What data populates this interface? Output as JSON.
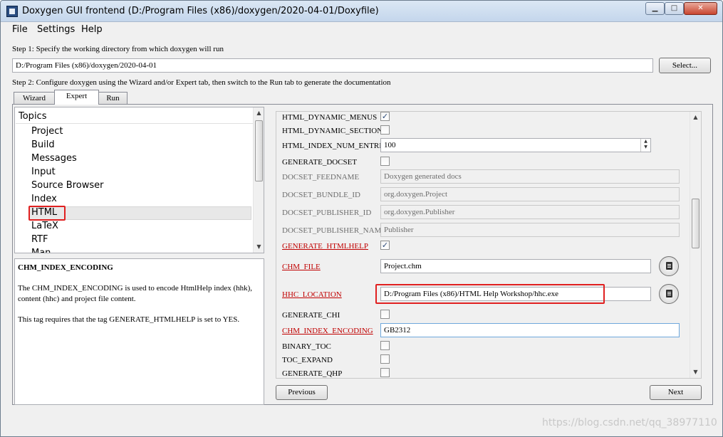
{
  "window": {
    "title": "Doxygen GUI frontend (D:/Program Files (x86)/doxygen/2020-04-01/Doxyfile)",
    "minimize_glyph": "▁",
    "maximize_glyph": "□",
    "close_glyph": "✕"
  },
  "menu": [
    "File",
    "Settings",
    "Help"
  ],
  "step1": {
    "label": "Step 1: Specify the working directory from which doxygen will run",
    "workdir": "D:/Program Files (x86)/doxygen/2020-04-01",
    "select_label": "Select..."
  },
  "step2": {
    "label": "Step 2: Configure doxygen using the Wizard and/or Expert tab, then switch to the Run tab to generate the documentation"
  },
  "tabs": [
    "Wizard",
    "Expert",
    "Run"
  ],
  "active_tab": "Expert",
  "topics": {
    "header": "Topics",
    "items": [
      "Project",
      "Build",
      "Messages",
      "Input",
      "Source Browser",
      "Index",
      "HTML",
      "LaTeX",
      "RTF",
      "Man"
    ],
    "selected": "HTML"
  },
  "help": {
    "title": "CHM_INDEX_ENCODING",
    "paragraph1": "The CHM_INDEX_ENCODING is used to encode HtmlHelp index (hhk), content (hhc) and project file content.",
    "paragraph2": "This tag requires that the tag GENERATE_HTMLHELP is set to YES."
  },
  "settings": [
    {
      "label": "HTML_DYNAMIC_MENUS",
      "type": "checkbox",
      "checked": true
    },
    {
      "label": "HTML_DYNAMIC_SECTIONS",
      "type": "checkbox",
      "checked": false
    },
    {
      "label": "HTML_INDEX_NUM_ENTRIES",
      "type": "spin",
      "value": "100"
    },
    {
      "label": "GENERATE_DOCSET",
      "type": "checkbox",
      "checked": false
    },
    {
      "label": "DOCSET_FEEDNAME",
      "type": "text",
      "value": "Doxygen generated docs",
      "disabled": true
    },
    {
      "label": "DOCSET_BUNDLE_ID",
      "type": "text",
      "value": "org.doxygen.Project",
      "disabled": true
    },
    {
      "label": "DOCSET_PUBLISHER_ID",
      "type": "text",
      "value": "org.doxygen.Publisher",
      "disabled": true
    },
    {
      "label": "DOCSET_PUBLISHER_NAME",
      "type": "text",
      "value": "Publisher",
      "disabled": true
    },
    {
      "label": "GENERATE_HTMLHELP",
      "type": "checkbox",
      "checked": true,
      "modified": true
    },
    {
      "label": "CHM_FILE",
      "type": "file",
      "value": "Project.chm",
      "modified": true
    },
    {
      "label": "HHC_LOCATION",
      "type": "file",
      "value": "D:/Program Files (x86)/HTML Help Workshop/hhc.exe",
      "modified": true
    },
    {
      "label": "GENERATE_CHI",
      "type": "checkbox",
      "checked": false
    },
    {
      "label": "CHM_INDEX_ENCODING",
      "type": "text",
      "value": "GB2312",
      "modified": true
    },
    {
      "label": "BINARY_TOC",
      "type": "checkbox",
      "checked": false
    },
    {
      "label": "TOC_EXPAND",
      "type": "checkbox",
      "checked": false
    },
    {
      "label": "GENERATE_QHP",
      "type": "checkbox",
      "checked": false
    }
  ],
  "nav": {
    "previous": "Previous",
    "next": "Next"
  },
  "watermark": "https://blog.csdn.net/qq_38977110",
  "colors": {
    "modified_label": "#c00000",
    "highlight_box": "#e02020"
  }
}
